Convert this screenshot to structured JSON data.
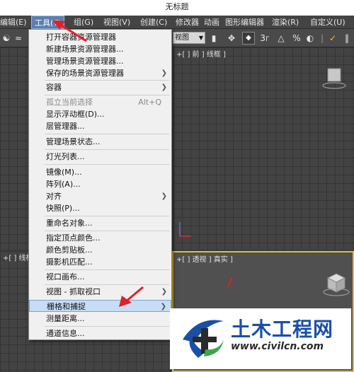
{
  "window": {
    "title": "无标题"
  },
  "menubar": {
    "items": [
      "编辑(E)",
      "工具(T)",
      "组(G)",
      "视图(V)",
      "创建(C)",
      "修改器",
      "动画",
      "图形编辑器",
      "渲染(R)",
      "自定义(U)"
    ]
  },
  "toolbar": {
    "view_select": "视图",
    "snap_label": "3",
    "percent_label": "%"
  },
  "viewports": {
    "top_left": "",
    "top_right": "+[ ] 前 ] 线框 ]",
    "bottom_left": "+[ ] 线框 ]",
    "bottom_right": "+[ ] 透视 ] 真实 ]"
  },
  "menu": {
    "items": [
      {
        "label": "打开容器资源管理器"
      },
      {
        "label": "新建场景资源管理器..."
      },
      {
        "label": "管理场景资源管理器..."
      },
      {
        "label": "保存的场景资源管理器",
        "submenu": true
      },
      {
        "label": "容器",
        "submenu": true
      },
      {
        "label": "孤立当前选择",
        "shortcut": "Alt+Q",
        "disabled": true
      },
      {
        "label": "显示浮动框(D)..."
      },
      {
        "label": "层管理器..."
      },
      {
        "label": "管理场景状态..."
      },
      {
        "label": "灯光列表..."
      },
      {
        "label": "镜像(M)..."
      },
      {
        "label": "阵列(A)..."
      },
      {
        "label": "对齐",
        "submenu": true
      },
      {
        "label": "快照(P)..."
      },
      {
        "label": "重命名对象..."
      },
      {
        "label": "指定顶点颜色..."
      },
      {
        "label": "颜色剪贴板..."
      },
      {
        "label": "摄影机匹配..."
      },
      {
        "label": "视口画布..."
      },
      {
        "label": "视图 - 抓取视口",
        "submenu": true
      },
      {
        "label": "栅格和捕捉",
        "submenu": true,
        "highlighted": true
      },
      {
        "label": "测量距离..."
      },
      {
        "label": "通道信息..."
      }
    ]
  },
  "watermark": {
    "name": "土木工程网",
    "url": "www.civilcn.com"
  },
  "colors": {
    "menu_highlight": "#c7ddf5",
    "annotation_arrow": "#e0202a",
    "viewport_active_border": "#e8c020",
    "watermark_blue": "#1a4fa8"
  }
}
